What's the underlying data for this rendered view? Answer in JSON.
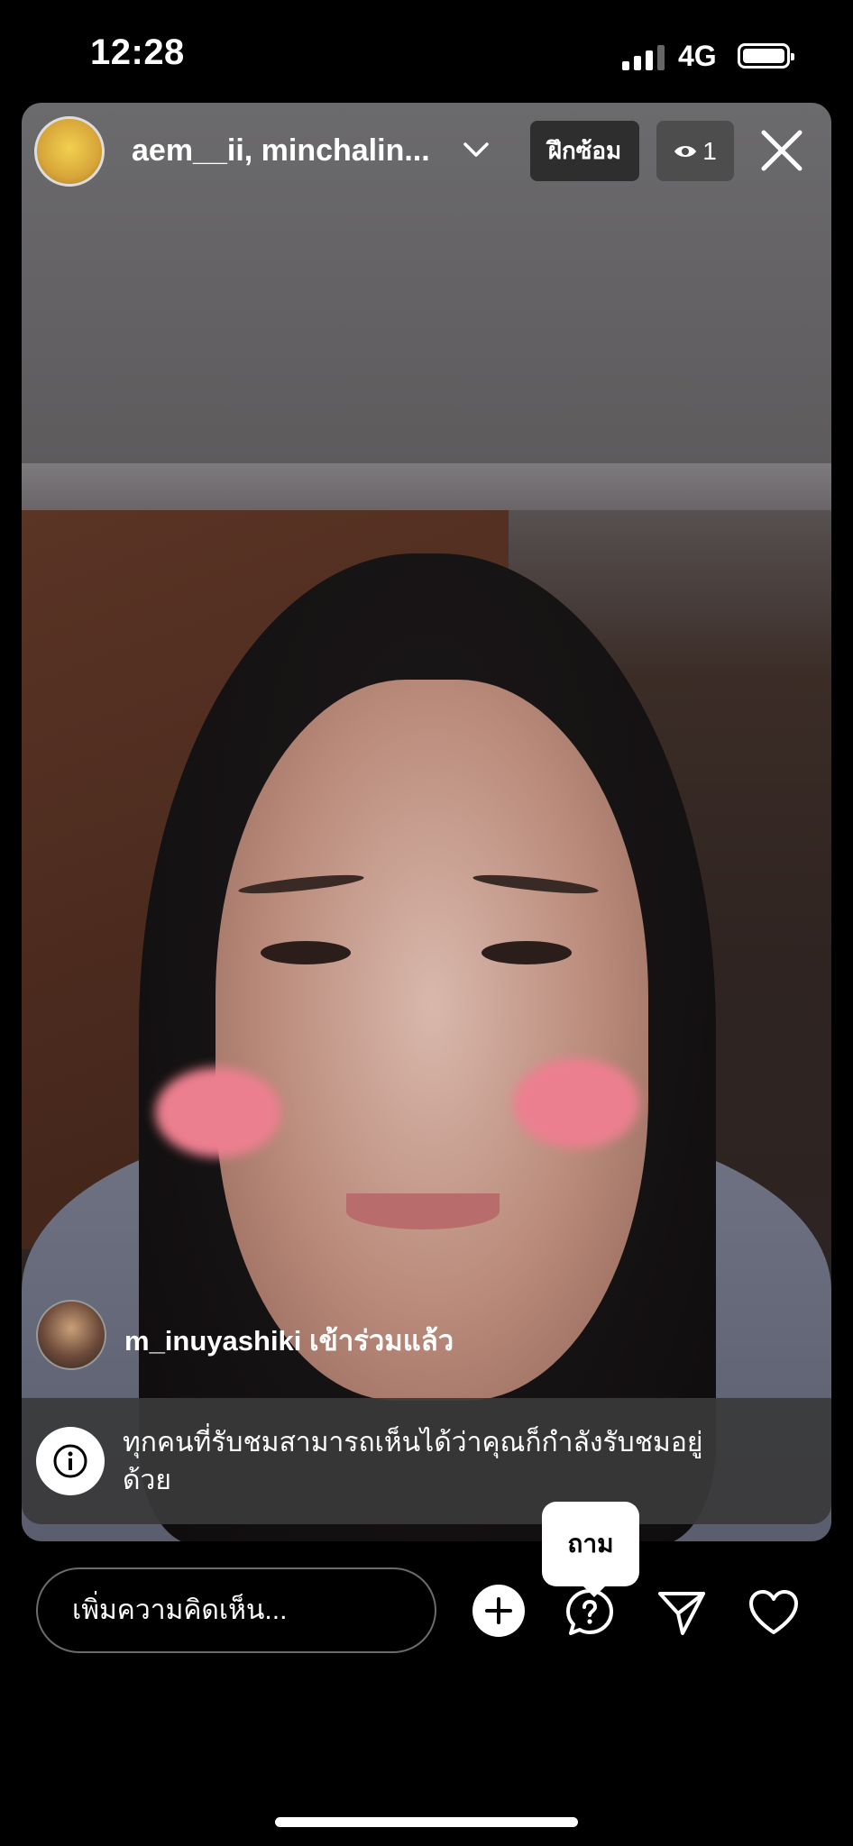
{
  "status_bar": {
    "time": "12:28",
    "network": "4G"
  },
  "live": {
    "host_names": "aem__ii, minchalin...",
    "practice_label": "ฝึกซ้อม",
    "viewer_count": "1"
  },
  "join_event": {
    "text": "m_inuyashiki เข้าร่วมแล้ว"
  },
  "info_banner": {
    "text": "ทุกคนที่รับชมสามารถเห็นได้ว่าคุณก็กำลังรับชมอยู่ด้วย"
  },
  "tooltip": {
    "text": "ถาม"
  },
  "comment_box": {
    "placeholder": "เพิ่มความคิดเห็น..."
  },
  "icons": [
    "chevron-down-icon",
    "eye-icon",
    "close-icon",
    "info-icon",
    "add-icon",
    "question-bubble-icon",
    "send-icon",
    "heart-icon"
  ]
}
